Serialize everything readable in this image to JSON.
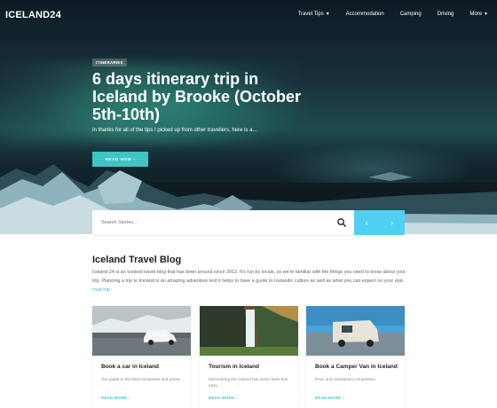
{
  "header": {
    "logo": "ICELAND24",
    "nav": [
      {
        "label": "Travel Tips",
        "dropdown": true
      },
      {
        "label": "Accommodation",
        "dropdown": false
      },
      {
        "label": "Camping",
        "dropdown": false
      },
      {
        "label": "Driving",
        "dropdown": false
      },
      {
        "label": "More",
        "dropdown": true
      }
    ]
  },
  "hero": {
    "badge": "ITINERARIES",
    "title": "6 days itinerary trip in Iceland by Brooke (October 5th-10th)",
    "subtitle": "In thanks for all of the tips I picked up from other travellers, here is a...",
    "read_button": "READ NOW  ›"
  },
  "search": {
    "placeholder": "Search Stories..."
  },
  "blog": {
    "title": "Iceland Travel Blog",
    "text": "Iceland 24 is an Iceland travel blog that has been around since 2013. It's run by locals, so we're familiar with the things you need to know about your trip. Planning a trip to Iceland is an amazing adventure and it helps to have a guide to Icelandic culture as well as what you can expect on your epic ",
    "link": "road trip",
    "text_end": "."
  },
  "cards": [
    {
      "title": "Book a car in Iceland",
      "desc": "Our guide to the best companies and prices",
      "more": "READ MORE  ›"
    },
    {
      "title": "Tourism in Iceland",
      "desc": "Discovering the Iceland has never been this easy.",
      "more": "READ MORE  ›"
    },
    {
      "title": "Book a Camper Van in Iceland",
      "desc": "Price and companies comparison.",
      "more": "READ MORE  ›"
    }
  ],
  "colors": {
    "accent": "#40c4c4",
    "arrows": "#4fd0f0",
    "link": "#40b7d8"
  }
}
